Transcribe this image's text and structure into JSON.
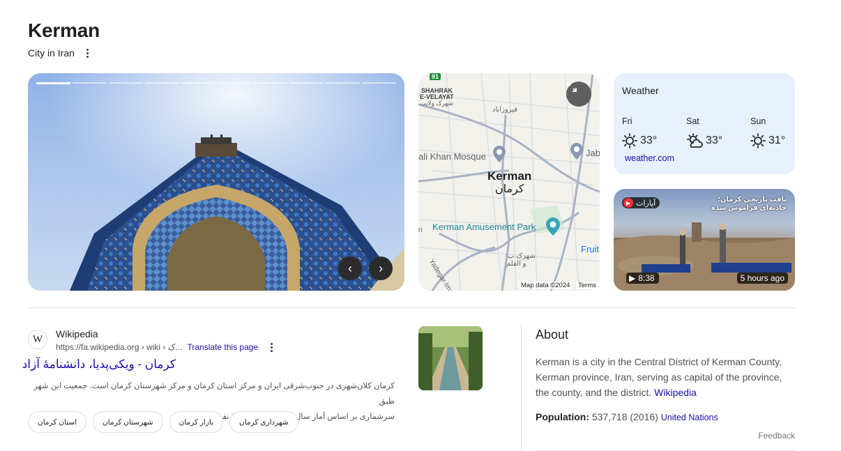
{
  "header": {
    "title": "Kerman",
    "subtitle": "City in Iran"
  },
  "hero": {
    "slides_total": 10,
    "active_slide": 1,
    "prev_label": "‹",
    "next_label": "›"
  },
  "map": {
    "highway": "91",
    "labels": {
      "shahrak_en": "SHAHRAK",
      "shahrak_en2": "E-VELAYAT",
      "shahrak_fa": "شهرک ولایت",
      "firouzabad": "فیروزاباد",
      "ebrahim": "ali Khan Mosque",
      "jab": "Jab",
      "city_en": "Kerman",
      "city_fa": "کرمان",
      "amusement": "Kerman Amusement Park",
      "fruit": "Fruit",
      "ri": "ri",
      "yadegar": "Yadegar-Imam Hwy",
      "shahrak_b": "شهرک ب",
      "qalam": "و القلم"
    },
    "credit": "Map data ©2024",
    "terms": "Terms"
  },
  "weather": {
    "title": "Weather",
    "days": [
      {
        "day": "Fri",
        "temp": "33°",
        "icon": "sun-icon"
      },
      {
        "day": "Sat",
        "temp": "33°",
        "icon": "partly-cloudy-icon"
      },
      {
        "day": "Sun",
        "temp": "31°",
        "icon": "sun-icon"
      }
    ],
    "source": "weather.com"
  },
  "video": {
    "badge": "آپارات",
    "caption": "بافت تاریخی کرمان؛ جاذبه‌ای فراموش شده",
    "duration": "8:38",
    "ago": "5 hours ago"
  },
  "result": {
    "favicon_letter": "W",
    "source_name": "Wikipedia",
    "url": "https://fa.wikipedia.org › wiki › ک...",
    "translate": "Translate this page",
    "title": "کرمان - ویکی‌پدیا، دانشنامهٔ آزاد",
    "snippet_line1": "کرمان کلان‌شهری در جنوب‌شرقی ایران و مرکز استان کرمان و مرکز شهرستان کرمان است. جمعیت این شهر طبق",
    "snippet_line2": "سرشماری بر اساس آمار سال ۹۵ معادل ۵۳۷٬۷۱۸ نفر بوده‌است.",
    "chips": [
      "استان کرمان",
      "شهرستان کرمان",
      "بازار کرمان",
      "شهرداری کرمان"
    ]
  },
  "about": {
    "title": "About",
    "text": "Kerman is a city in the Central District of Kerman County, Kerman province, Iran, serving as capital of the province, the county, and the district.",
    "link": "Wikipedia",
    "population_label": "Population:",
    "population_value": "537,718 (2016)",
    "population_source": "United Nations",
    "feedback": "Feedback"
  }
}
